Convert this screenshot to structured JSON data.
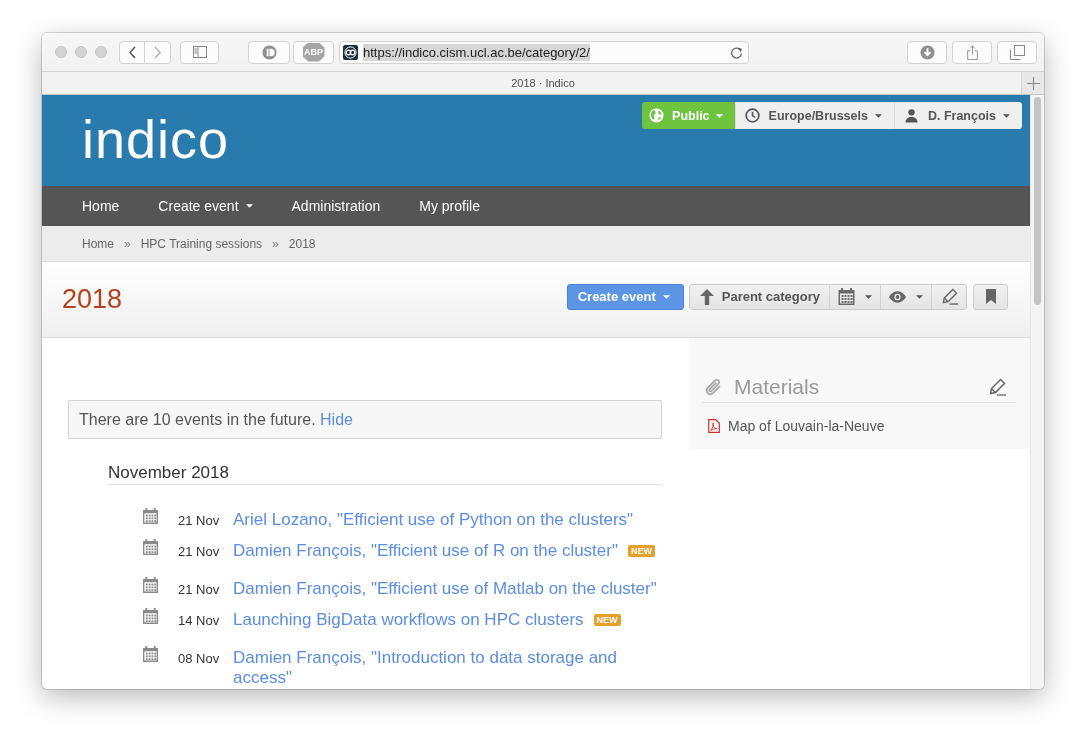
{
  "browser": {
    "back": {
      "disabled": false
    },
    "forward": {
      "disabled": true
    },
    "extension_badge": "ABP",
    "address_bar": {
      "value": "https://indico.cism.ucl.ac.be/category/2/",
      "selected": true
    },
    "tab_title": "2018 · Indico"
  },
  "header": {
    "logo": "indico",
    "menus": [
      {
        "kind": "protection",
        "label": "Public"
      },
      {
        "kind": "timezone",
        "label": "Europe/Brussels"
      },
      {
        "kind": "user",
        "label": "D. François"
      }
    ]
  },
  "nav": [
    {
      "label": "Home",
      "dropdown": false
    },
    {
      "label": "Create event",
      "dropdown": true
    },
    {
      "label": "Administration",
      "dropdown": false
    },
    {
      "label": "My profile",
      "dropdown": false
    }
  ],
  "breadcrumbs": [
    {
      "kind": "link",
      "text": "Home"
    },
    {
      "kind": "separator",
      "text": "»"
    },
    {
      "kind": "link",
      "text": "HPC Training sessions"
    },
    {
      "kind": "separator",
      "text": "»"
    },
    {
      "kind": "current",
      "text": "2018"
    }
  ],
  "category": {
    "title": "2018",
    "create_button": "Create event",
    "parent_button": "Parent category"
  },
  "future_notice": {
    "text": "There are 10 events in the future.",
    "link": "Hide"
  },
  "events": {
    "month": "November 2018",
    "items": [
      {
        "date": "21 Nov",
        "title": "Ariel Lozano, \"Efficient use of Python on the clusters\""
      },
      {
        "date": "21 Nov",
        "title": "Damien François, \"Efficient use of R on the cluster\"",
        "badge": "NEW"
      },
      {
        "date": "21 Nov",
        "title": "Damien François, \"Efficient use of Matlab on the cluster\""
      },
      {
        "date": "14 Nov",
        "title": "Launching BigData workflows on HPC clusters",
        "badge": "NEW"
      },
      {
        "date": "08 Nov",
        "title": "Damien François, \"Introduction to data storage and access\""
      }
    ]
  },
  "materials": {
    "title": "Materials",
    "items": [
      {
        "kind": "pdf",
        "label": "Map of Louvain-la-Neuve"
      }
    ]
  }
}
